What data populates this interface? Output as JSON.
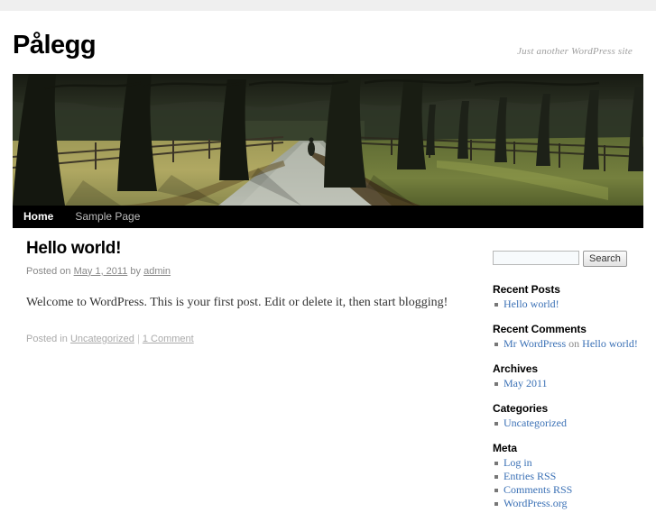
{
  "site": {
    "title": "Pålegg",
    "description": "Just another WordPress site"
  },
  "nav": {
    "items": [
      {
        "label": "Home",
        "current": true
      },
      {
        "label": "Sample Page",
        "current": false
      }
    ]
  },
  "header_image": {
    "alt": "tree-lined-path-header-image"
  },
  "post": {
    "title": "Hello world!",
    "meta": {
      "posted_on_label": "Posted on",
      "date": "May 1, 2011",
      "by_label": "by",
      "author": "admin"
    },
    "content": "Welcome to WordPress. This is your first post. Edit or delete it, then start blogging!",
    "utility": {
      "posted_in_label": "Posted in",
      "category": "Uncategorized",
      "separator": "|",
      "comments": "1 Comment"
    }
  },
  "sidebar": {
    "search": {
      "value": "",
      "placeholder": "",
      "button_label": "Search"
    },
    "widgets": [
      {
        "title": "Recent Posts",
        "items": [
          {
            "link": "Hello world!"
          }
        ]
      },
      {
        "title": "Recent Comments",
        "items": [
          {
            "link": "Mr WordPress",
            "middle": "on",
            "link2": "Hello world!"
          }
        ]
      },
      {
        "title": "Archives",
        "items": [
          {
            "link": "May 2011"
          }
        ]
      },
      {
        "title": "Categories",
        "items": [
          {
            "link": "Uncategorized"
          }
        ]
      },
      {
        "title": "Meta",
        "items": [
          {
            "link": "Log in"
          },
          {
            "link": "Entries RSS"
          },
          {
            "link": "Comments RSS"
          },
          {
            "link": "WordPress.org"
          }
        ]
      }
    ]
  },
  "colors": {
    "link": "#3a70b5",
    "nav_background": "#000000",
    "top_band": "#efefef",
    "muted_text": "#888888"
  }
}
